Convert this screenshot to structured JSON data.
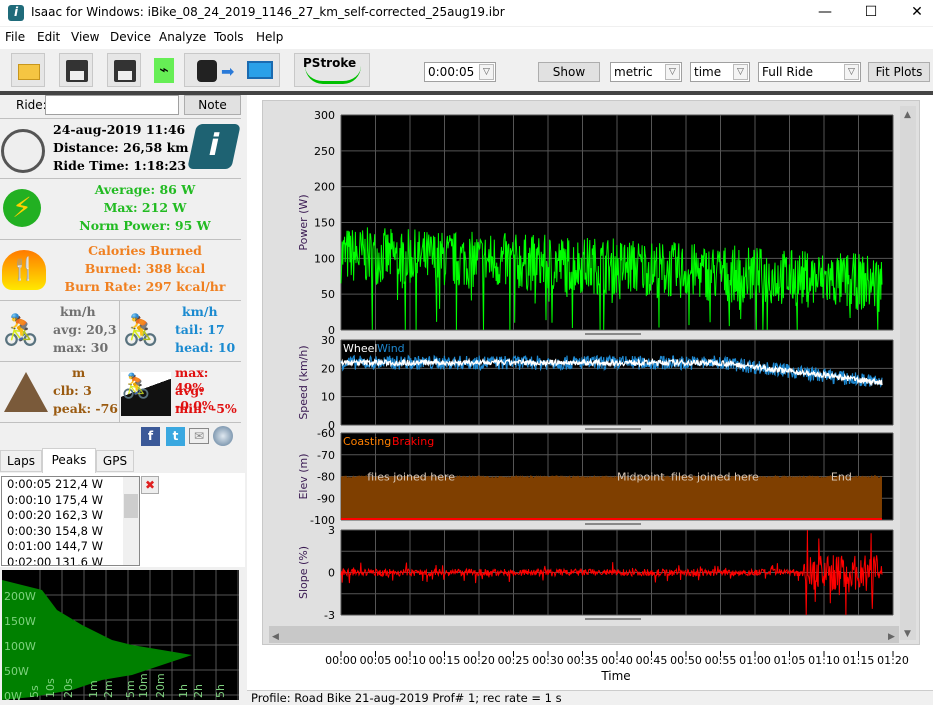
{
  "window": {
    "title": "Isaac for Windows:  iBike_08_24_2019_1146_27_km_self-corrected_25aug19.ibr",
    "minimize": "—",
    "maximize": "☐",
    "close": "✕"
  },
  "menu": [
    "File",
    "Edit",
    "View",
    "Device",
    "Analyze",
    "Tools",
    "Help"
  ],
  "toolbar": {
    "icons": [
      "open-folder-icon",
      "save-icon",
      "save-as-icon",
      "usb-icon",
      "device-to-pc-icon",
      "pstroke-icon"
    ],
    "pstroke_label": "PStroke",
    "interval": "0:00:05",
    "show": "Show",
    "units": "metric",
    "xaxis": "time",
    "range": "Full Ride",
    "fit": "Fit Plots"
  },
  "ride": {
    "label": "Ride:",
    "value": "",
    "note": "Note"
  },
  "summary": {
    "datetime": "24-aug-2019 11:46",
    "distance": "Distance: 26,58 km",
    "ride_time": "Ride Time: 1:18:23"
  },
  "power": {
    "average": "Average: 86 W",
    "max": "Max: 212 W",
    "norm": "Norm Power: 95 W"
  },
  "calories": {
    "title": "Calories Burned",
    "burned": "Burned: 388 kcal",
    "rate": "Burn Rate: 297 kcal/hr"
  },
  "speed": {
    "unit": "km/h",
    "avg": "avg: 20,3",
    "max": "max: 30"
  },
  "wind": {
    "unit": "km/h",
    "tail": "tail: 17",
    "head": "head: 10"
  },
  "elev": {
    "unit": "m",
    "climb": "clb: 3",
    "peak": "peak: -76"
  },
  "slope": {
    "max": "max: 49%",
    "avg": "avg: -0,0%",
    "min": "min: -5%"
  },
  "tabs": [
    "Laps",
    "Peaks",
    "GPS"
  ],
  "peaks": [
    "0:00:05 212,4 W",
    "0:00:10 175,4 W",
    "0:00:20 162,3 W",
    "0:00:30 154,8 W",
    "0:01:00 144,7 W",
    "0:02:00 131,6 W"
  ],
  "peak_chart": {
    "y_ticks": [
      "200W",
      "150W",
      "100W",
      "50W",
      "0W"
    ],
    "x_ticks": [
      "5s",
      "10s",
      "20s",
      "1m",
      "2m",
      "5m",
      "10m",
      "20m",
      "1h",
      "2h",
      "5h"
    ],
    "fill": "#008000"
  },
  "chart_data": [
    {
      "type": "line",
      "ylabel": "Power (W)",
      "ylim": [
        0,
        300
      ],
      "yticks": [
        0,
        50,
        100,
        150,
        200,
        250,
        300
      ],
      "xlim_min": [
        0,
        80
      ],
      "color": "#00ff00",
      "grid": true
    },
    {
      "type": "line",
      "ylabel": "Speed (km/h)",
      "ylim": [
        0,
        30
      ],
      "yticks": [
        0,
        10,
        20,
        30
      ],
      "series": [
        {
          "name": "Wheel",
          "color": "#ffffff"
        },
        {
          "name": "Wind",
          "color": "#1e88d0"
        }
      ],
      "grid": true
    },
    {
      "type": "area",
      "ylabel": "Elev (m)",
      "ylim": [
        -100,
        -60
      ],
      "yticks": [
        -100,
        -90,
        -80,
        -70,
        -60
      ],
      "series": [
        {
          "name": "Coasting",
          "color": "#ff8000"
        },
        {
          "name": "Braking",
          "color": "#ff0000"
        }
      ],
      "fill": "#7f3f00",
      "annotations": [
        "files joined here",
        "Midpoint",
        "files joined here",
        "End"
      ],
      "grid": true
    },
    {
      "type": "line",
      "ylabel": "Slope (%)",
      "ylim": [
        -3,
        3
      ],
      "yticks": [
        -3,
        0,
        3
      ],
      "color": "#ff0000",
      "grid": true
    }
  ],
  "xaxis": {
    "title": "Time",
    "ticks": [
      "00:00",
      "00:05",
      "00:10",
      "00:15",
      "00:20",
      "00:25",
      "00:30",
      "00:35",
      "00:40",
      "00:45",
      "00:50",
      "00:55",
      "01:00",
      "01:05",
      "01:10",
      "01:15",
      "01:20"
    ]
  },
  "status": "Profile: Road Bike 21-aug-2019 Prof# 1; rec rate = 1 s"
}
